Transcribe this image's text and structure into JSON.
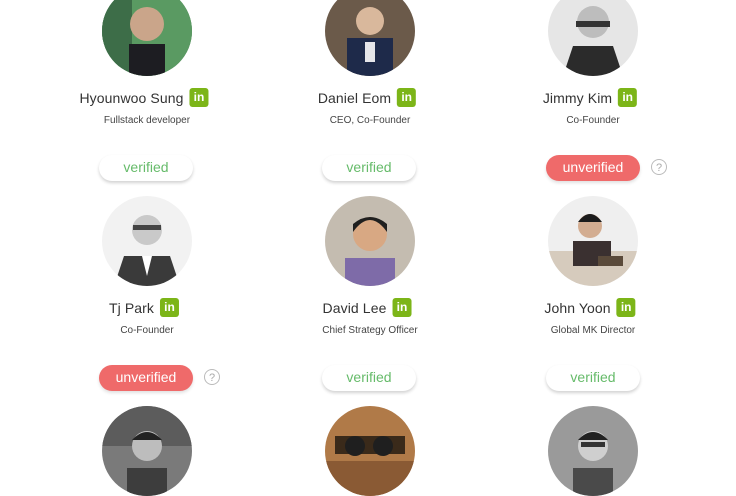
{
  "members": [
    {
      "name": "Hyounwoo Sung",
      "role": "Fullstack developer",
      "status": "verified",
      "linkedin": "in"
    },
    {
      "name": "Daniel Eom",
      "role": "CEO, Co-Founder",
      "status": "verified",
      "linkedin": "in"
    },
    {
      "name": "Jimmy Kim",
      "role": "Co-Founder",
      "status": "unverified",
      "linkedin": "in",
      "help": "?"
    },
    {
      "name": "Tj Park",
      "role": "Co-Founder",
      "status": "unverified",
      "linkedin": "in",
      "help": "?"
    },
    {
      "name": "David Lee",
      "role": "Chief Strategy Officer",
      "status": "verified",
      "linkedin": "in"
    },
    {
      "name": "John Yoon",
      "role": "Global MK Director",
      "status": "verified",
      "linkedin": "in"
    }
  ],
  "top_badges": [
    "verified",
    "verified",
    "unverified"
  ],
  "top_help": "?",
  "colors": {
    "linkedin": "#7cb518",
    "verified_text": "#66bb6a",
    "unverified_bg": "#ef6a6a"
  }
}
